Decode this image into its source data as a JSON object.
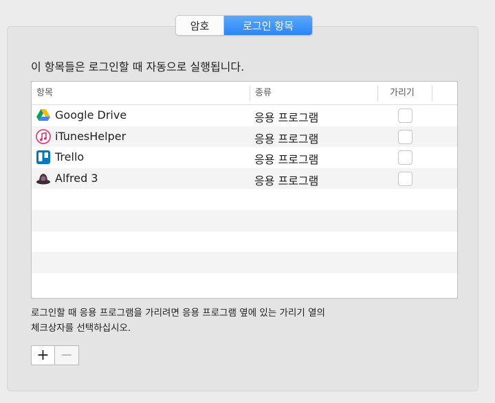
{
  "tabs": [
    {
      "label": "암호"
    },
    {
      "label": "로그인 항목"
    }
  ],
  "description": "이 항목들은 로그인할 때 자동으로 실행됩니다.",
  "table": {
    "headers": {
      "item": "항목",
      "kind": "종류",
      "hide": "가리기"
    },
    "rows": [
      {
        "name": "Google Drive",
        "kind": "응용 프로그램",
        "icon": "google-drive-icon",
        "hidden": false
      },
      {
        "name": "iTunesHelper",
        "kind": "응용 프로그램",
        "icon": "itunes-icon",
        "hidden": false
      },
      {
        "name": "Trello",
        "kind": "응용 프로그램",
        "icon": "trello-icon",
        "hidden": false
      },
      {
        "name": "Alfred 3",
        "kind": "응용 프로그램",
        "icon": "alfred-icon",
        "hidden": false
      }
    ]
  },
  "hint_lines": [
    "로그인할 때 응용 프로그램을 가리려면 응용 프로그램 옆에 있는 가리기 열의",
    "체크상자를 선택하십시오."
  ],
  "buttons": {
    "add": "+",
    "remove": "−"
  },
  "colors": {
    "selected_tab": "#2a86f7",
    "stripe": "#f4f4f4"
  }
}
